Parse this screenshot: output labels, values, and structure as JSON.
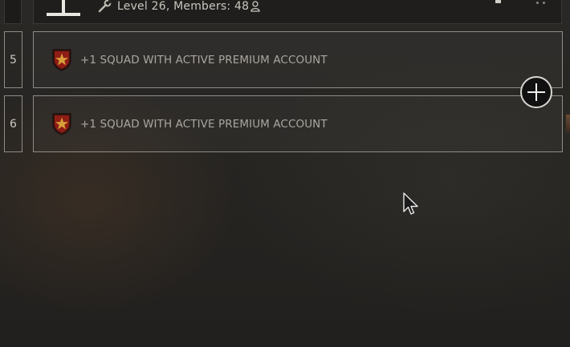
{
  "clan": {
    "info_text": "Level 26, Members: 48"
  },
  "slots": [
    {
      "number": "5",
      "label": "+1 SQUAD WITH ACTIVE PREMIUM ACCOUNT"
    },
    {
      "number": "6",
      "label": "+1 SQUAD WITH ACTIVE PREMIUM ACCOUNT"
    }
  ],
  "icons": {
    "wrench": "wrench-icon",
    "person": "person-icon",
    "badge": "premium-shield-icon",
    "add": "plus-icon"
  },
  "colors": {
    "border": "#8f8c86",
    "text": "#a9a69f",
    "badge_red": "#8e1d15",
    "badge_star": "#d9a03a"
  }
}
